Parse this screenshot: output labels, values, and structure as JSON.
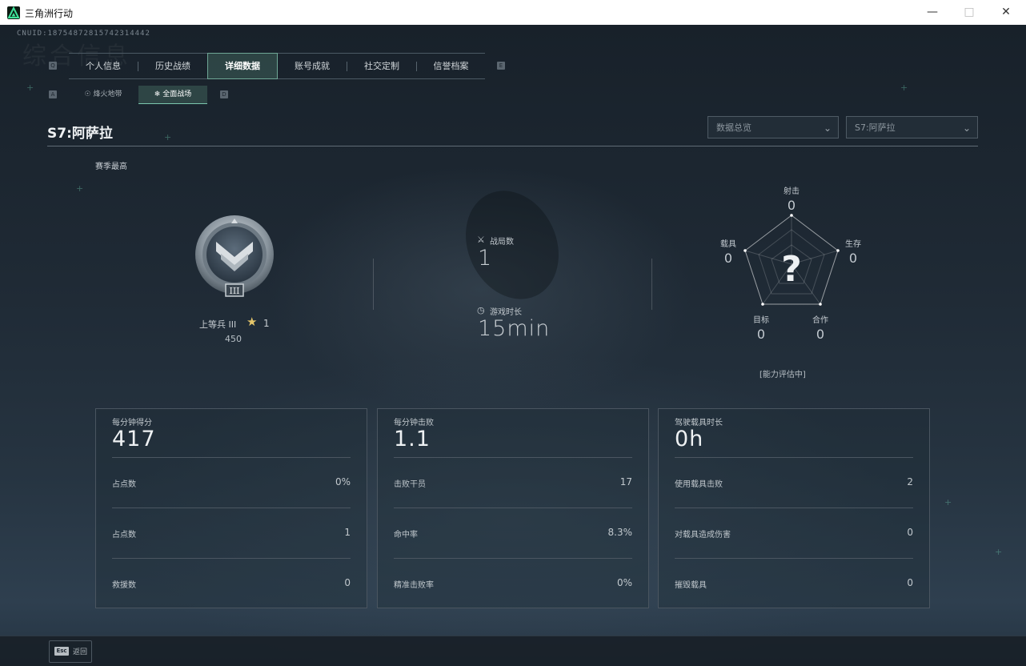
{
  "window": {
    "title": "三角洲行动"
  },
  "header": {
    "uid": "CNUID:18754872815742314442",
    "bg_text": "综合信息",
    "tabs": [
      {
        "label": "个人信息"
      },
      {
        "label": "历史战绩"
      },
      {
        "label": "详细数据",
        "active": true
      },
      {
        "label": "账号成就"
      },
      {
        "label": "社交定制"
      },
      {
        "label": "信誉档案"
      }
    ],
    "tab_prev_key": "Q",
    "tab_next_key": "E",
    "subtabs": [
      {
        "label": "烽火地带",
        "icon": "fire-zone-icon"
      },
      {
        "label": "全面战场",
        "icon": "battlefield-icon",
        "active": true
      }
    ],
    "subtab_prev_key": "A",
    "subtab_next_key": "D"
  },
  "season": {
    "title": "S7:阿萨拉",
    "filters": {
      "view": "数据总览",
      "season": "S7:阿萨拉"
    }
  },
  "rank": {
    "label": "赛季最高",
    "name": "上等兵 III",
    "badge_numeral": "III",
    "stars": "1",
    "score": "450"
  },
  "stats": {
    "matches_label": "战局数",
    "matches_value": "1",
    "playtime_label": "游戏时长",
    "playtime_value": "15min"
  },
  "radar": {
    "center": "?",
    "status": "[能力评估中]",
    "axes": [
      {
        "label": "射击",
        "value": "0"
      },
      {
        "label": "生存",
        "value": "0"
      },
      {
        "label": "合作",
        "value": "0"
      },
      {
        "label": "目标",
        "value": "0"
      },
      {
        "label": "载具",
        "value": "0"
      }
    ],
    "values": [
      0,
      0,
      0,
      0,
      0
    ]
  },
  "cards": [
    {
      "title": "每分钟得分",
      "value": "417",
      "rows": [
        {
          "label": "占点数",
          "value": "0%"
        },
        {
          "label": "占点数",
          "value": "1"
        },
        {
          "label": "救援数",
          "value": "0"
        }
      ]
    },
    {
      "title": "每分钟击败",
      "value": "1.1",
      "rows": [
        {
          "label": "击败干员",
          "value": "17"
        },
        {
          "label": "命中率",
          "value": "8.3%"
        },
        {
          "label": "精准击败率",
          "value": "0%"
        }
      ]
    },
    {
      "title": "驾驶载具时长",
      "value": "0h",
      "rows": [
        {
          "label": "使用载具击败",
          "value": "2"
        },
        {
          "label": "对载具造成伤害",
          "value": "0"
        },
        {
          "label": "摧毁载具",
          "value": "0"
        }
      ]
    }
  ],
  "footer": {
    "esc_key": "Esc",
    "esc_label": "返回"
  },
  "colors": {
    "accent": "#6fa796",
    "star": "#e5c66b",
    "panel": "#1c2630"
  }
}
